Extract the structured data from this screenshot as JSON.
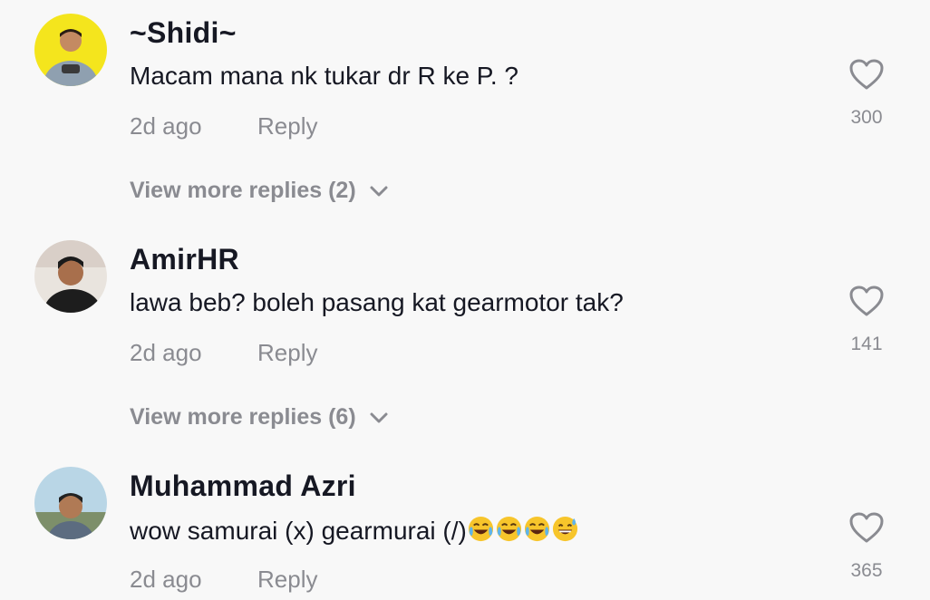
{
  "comments": [
    {
      "username": "~Shidi~",
      "text": "Macam mana nk tukar dr R ke P. ?",
      "age": "2d ago",
      "reply_label": "Reply",
      "likes": "300",
      "more_replies": "View more replies (2)",
      "avatar_color": "#f4e51d"
    },
    {
      "username": "AmirHR",
      "text": "lawa beb? boleh pasang kat gearmotor tak?",
      "age": "2d ago",
      "reply_label": "Reply",
      "likes": "141",
      "more_replies": "View more replies (6)",
      "avatar_color": "#2b2b2b"
    },
    {
      "username": "Muhammad Azri",
      "text": "wow samurai (x) gearmurai (/)",
      "emojis": [
        "face-with-tears-of-joy",
        "face-with-tears-of-joy",
        "face-with-tears-of-joy",
        "grinning-face-with-sweat"
      ],
      "age": "2d ago",
      "reply_label": "Reply",
      "likes": "365",
      "avatar_color": "#b9d6e6"
    }
  ],
  "colors": {
    "background": "#f8f8f8",
    "primary_text": "#161823",
    "secondary_text": "#8a8b91"
  }
}
